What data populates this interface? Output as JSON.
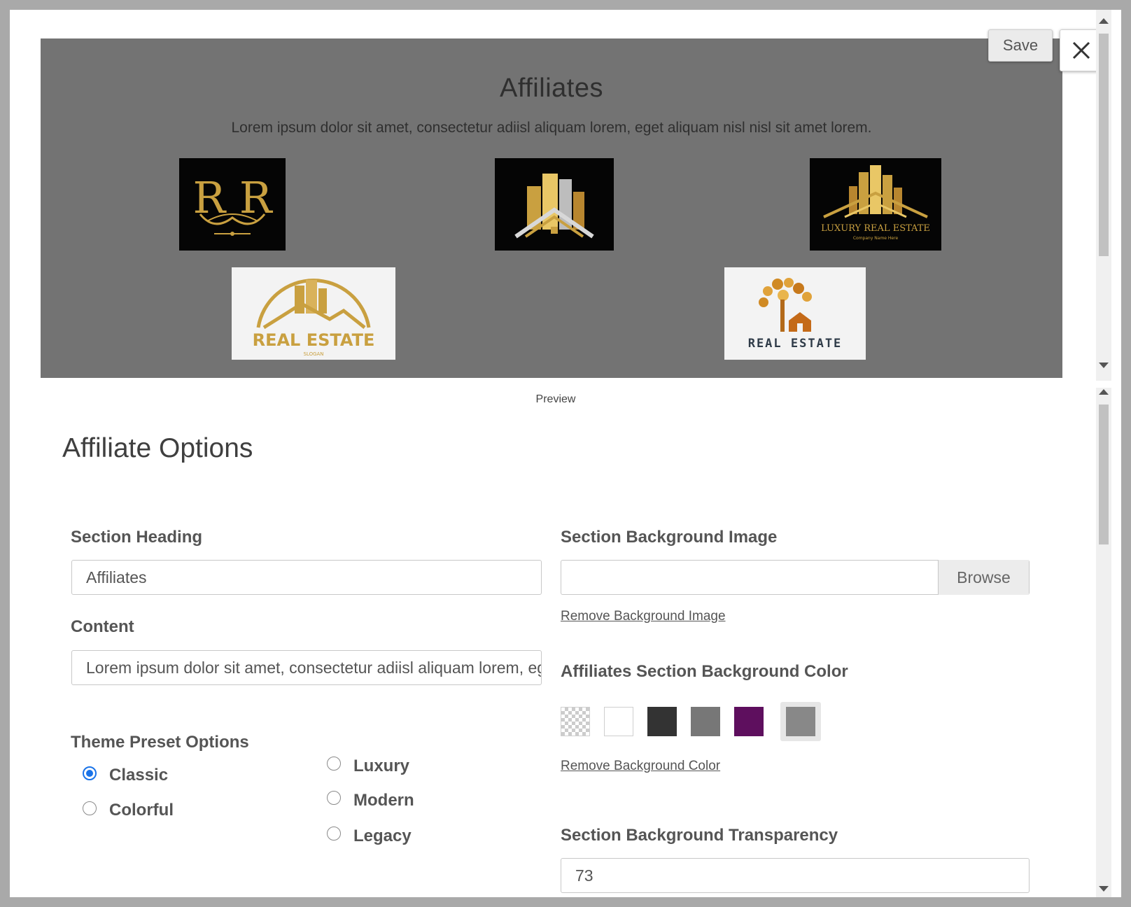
{
  "toolbar": {
    "save_label": "Save"
  },
  "preview": {
    "title": "Affiliates",
    "content": "Lorem ipsum dolor sit amet, consectetur adiisl aliquam lorem, eget aliquam nisl nisl sit amet lorem.",
    "caption": "Preview",
    "logos": [
      {
        "name": "rr-monogram-logo",
        "text": "R R"
      },
      {
        "name": "gold-buildings-logo",
        "text": ""
      },
      {
        "name": "luxury-real-estate-logo",
        "text": "LUXURY REAL ESTATE",
        "subtext": "Company Name Here"
      },
      {
        "name": "real-estate-arch-logo",
        "text": "REAL ESTATE",
        "subtext": "SLOGAN"
      },
      {
        "name": "real-estate-tree-logo",
        "text": "REAL ESTATE"
      }
    ]
  },
  "options": {
    "heading": "Affiliate Options",
    "section_heading": {
      "label": "Section Heading",
      "value": "Affiliates"
    },
    "content": {
      "label": "Content",
      "value": "Lorem ipsum dolor sit amet, consectetur adiisl aliquam lorem, eget aliquam nisl nisl sit amet lorem."
    },
    "theme": {
      "label": "Theme Preset Options",
      "options": [
        {
          "label": "Classic",
          "checked": true
        },
        {
          "label": "Colorful",
          "checked": false
        },
        {
          "label": "Luxury",
          "checked": false
        },
        {
          "label": "Modern",
          "checked": false
        },
        {
          "label": "Legacy",
          "checked": false
        }
      ]
    },
    "bg_image": {
      "label": "Section Background Image",
      "value": "",
      "browse_label": "Browse",
      "remove_label": "Remove Background Image"
    },
    "bg_color": {
      "label": "Affiliates Section Background Color",
      "swatches": [
        "transparent",
        "#ffffff",
        "#333333",
        "#777777",
        "#5e0f5e",
        "#888888"
      ],
      "selected_index": 5,
      "remove_label": "Remove Background Color"
    },
    "transparency": {
      "label": "Section Background Transparency",
      "value": "73"
    }
  },
  "colors": {
    "preview_bg": "#737373",
    "radio_accent": "#1a73e8",
    "gold": "#c9a040"
  }
}
